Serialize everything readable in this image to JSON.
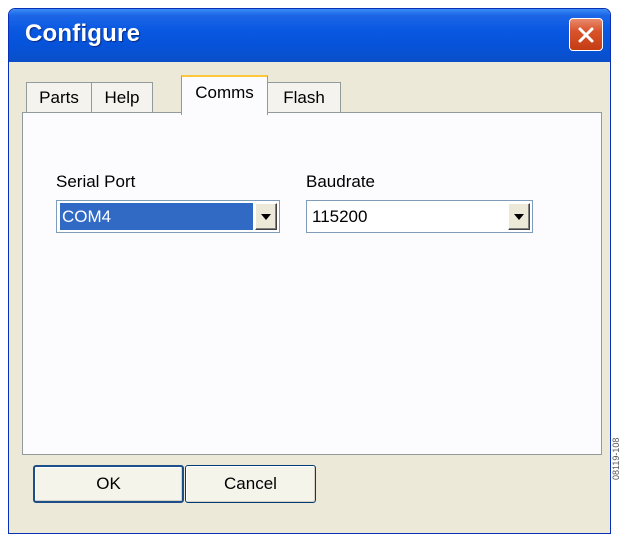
{
  "window": {
    "title": "Configure"
  },
  "tabs": [
    {
      "label": "Parts",
      "active": false
    },
    {
      "label": "Help",
      "active": false
    },
    {
      "label": "Comms",
      "active": true
    },
    {
      "label": "Flash",
      "active": false
    }
  ],
  "comms": {
    "serial_port": {
      "label": "Serial Port",
      "value": "COM4"
    },
    "baudrate": {
      "label": "Baudrate",
      "value": "115200"
    }
  },
  "buttons": {
    "ok": "OK",
    "cancel": "Cancel"
  },
  "side_code": "08119-108",
  "colors": {
    "titlebar": "#0653d9",
    "close": "#d8532b",
    "selection": "#316ac5",
    "dialog_bg": "#ece9d8"
  },
  "icons": {
    "close": "close-icon",
    "dropdown": "chevron-down-icon"
  }
}
